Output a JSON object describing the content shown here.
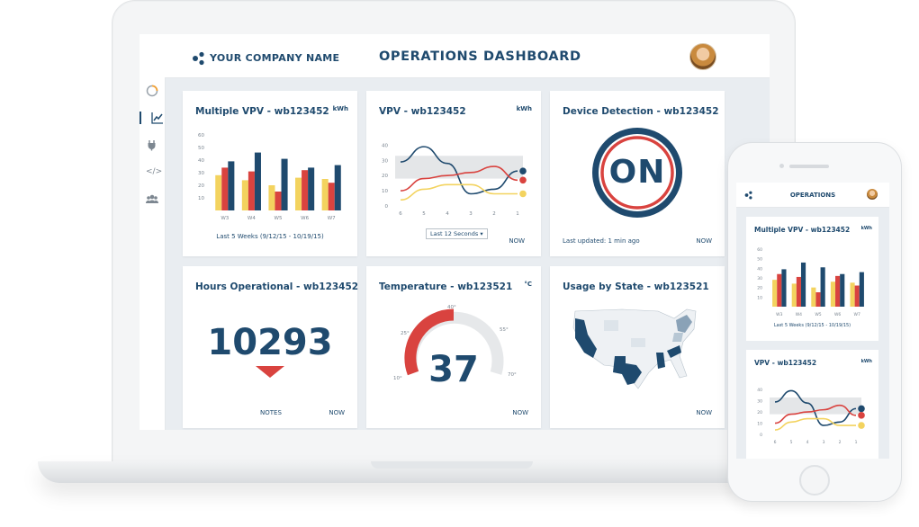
{
  "header": {
    "company": "YOUR COMPANY NAME",
    "title": "OPERATIONS DASHBOARD"
  },
  "colors": {
    "navy": "#1f4a6e",
    "red": "#d9433f",
    "yellow": "#f3d35f",
    "gray": "#e4e6e8",
    "light": "#e9edf1"
  },
  "sidebar": {
    "icons": [
      "timer-icon",
      "line-chart-icon",
      "plug-icon",
      "code-icon",
      "users-icon"
    ]
  },
  "cards": {
    "multi_vpv": {
      "title": "Multiple VPV - wb123452",
      "unit": "kWh",
      "range": "Last 5 Weeks (9/12/15 - 10/19/15)"
    },
    "vpv": {
      "title": "VPV - wb123452",
      "unit": "kWh",
      "select": "Last 12 Seconds",
      "select_arrow": "▾",
      "now": "NOW"
    },
    "device": {
      "title": "Device Detection - wb123452",
      "status": "ON",
      "updated": "Last updated: 1 min ago",
      "now": "NOW"
    },
    "hours": {
      "title": "Hours Operational - wb123452",
      "value": "10293",
      "notes": "NOTES",
      "now": "NOW"
    },
    "temp": {
      "title": "Temperature - wb123521",
      "unit": "°C",
      "value": "37",
      "scale": [
        "10°",
        "25°",
        "40°",
        "55°",
        "70°"
      ],
      "now": "NOW"
    },
    "usage": {
      "title": "Usage by State - wb123521",
      "now": "NOW"
    }
  },
  "phone": {
    "title": "OPERATIONS",
    "multi_vpv": {
      "title": "Multiple VPV - wb123452",
      "unit": "kWh",
      "range": "Last 5 Weeks (9/12/15 - 10/19/15)"
    },
    "vpv": {
      "title": "VPV - wb123452",
      "unit": "kWh"
    }
  },
  "chart_data": [
    {
      "type": "bar",
      "title": "Multiple VPV - wb123452",
      "categories": [
        "W3",
        "W4",
        "W5",
        "W6",
        "W7"
      ],
      "series": [
        {
          "values": [
            28,
            24,
            20,
            26,
            25
          ]
        },
        {
          "values": [
            34,
            31,
            15,
            32,
            22
          ]
        },
        {
          "values": [
            39,
            46,
            41,
            34,
            36
          ]
        }
      ],
      "yticks": [
        0,
        10,
        20,
        30,
        40,
        50,
        60
      ],
      "ylim": [
        0,
        60
      ]
    },
    {
      "type": "line",
      "title": "VPV - wb123452",
      "x": [
        6,
        5,
        4,
        3,
        2,
        1
      ],
      "yticks": [
        0,
        10,
        20,
        30,
        40
      ],
      "ylim": [
        0,
        45
      ],
      "series": [
        {
          "values": [
            29,
            39,
            28,
            8,
            11,
            23
          ]
        },
        {
          "values": [
            10,
            18,
            20,
            22,
            26,
            17
          ]
        },
        {
          "values": [
            4,
            11,
            14,
            14,
            8,
            8
          ]
        }
      ]
    }
  ]
}
